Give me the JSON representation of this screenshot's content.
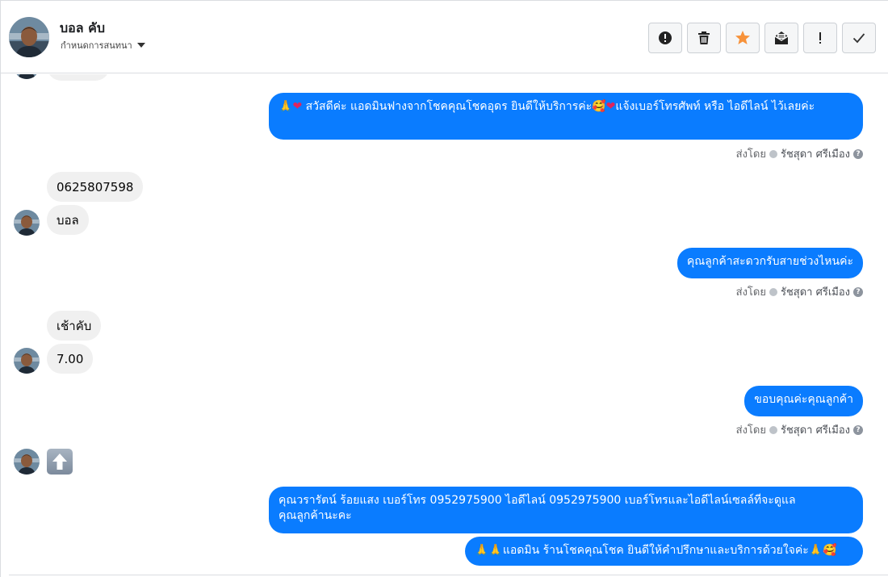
{
  "header": {
    "contact_name": "บอล คับ",
    "assign_label": "กำหนดการสนทนา",
    "actions": [
      {
        "name": "report-button",
        "icon": "alert-circle-icon"
      },
      {
        "name": "delete-button",
        "icon": "trash-icon"
      },
      {
        "name": "star-button",
        "icon": "star-icon"
      },
      {
        "name": "mark-unread-button",
        "icon": "envelope-open-icon"
      },
      {
        "name": "important-button",
        "icon": "exclamation-icon"
      },
      {
        "name": "done-button",
        "icon": "check-icon"
      }
    ],
    "star_color": "#f7923a"
  },
  "messages": {
    "m1": {
      "pre": "🙏",
      "heart1": "❤",
      "text": " สวัสดีค่ะ แอดมินฟางจากโชคคุณโชคอุดร ยินดีให้บริการค่ะ",
      "blush": "🥰",
      "heart2": "❤",
      "text2": "แจ้งเบอร์โทรศัพท์ หรือ ไอดีไลน์  ไว้เลยค่ะ"
    },
    "m2": "0625807598",
    "m3": "บอล",
    "m4": "คุณลูกค้าสะดวกรับสายช่วงไหนค่ะ",
    "m5": "เช้าคับ",
    "m6": "7.00",
    "m7": "ขอบคุณค่ะคุณลูกค้า",
    "m8": {
      "line1": "คุณวรารัตน์ ร้อยแสง       เบอร์โทร 0952975900  ไอดีไลน์ 0952975900   เบอร์โทรและไอดีไลน์เซลล์ที่จะดูแล",
      "line2": "คุณลูกค้านะคะ"
    },
    "m9": {
      "pray": "🙏🙏",
      "text": "แอดมิน ร้านโชคคุณโชค ยินดีให้คำปรึกษาและบริการด้วยใจค่ะ",
      "pray2": "🙏",
      "blush": "🥰"
    },
    "sticker_icon": "arrow-up-icon"
  },
  "sent_by": {
    "prefix": "ส่งโดย",
    "agent": "รัชสุดา ศรีเมือง",
    "help": "?"
  },
  "colors": {
    "outgoing_bubble": "#0a7cff",
    "incoming_bubble": "#f0f0f0",
    "meta_text": "#65676b"
  }
}
